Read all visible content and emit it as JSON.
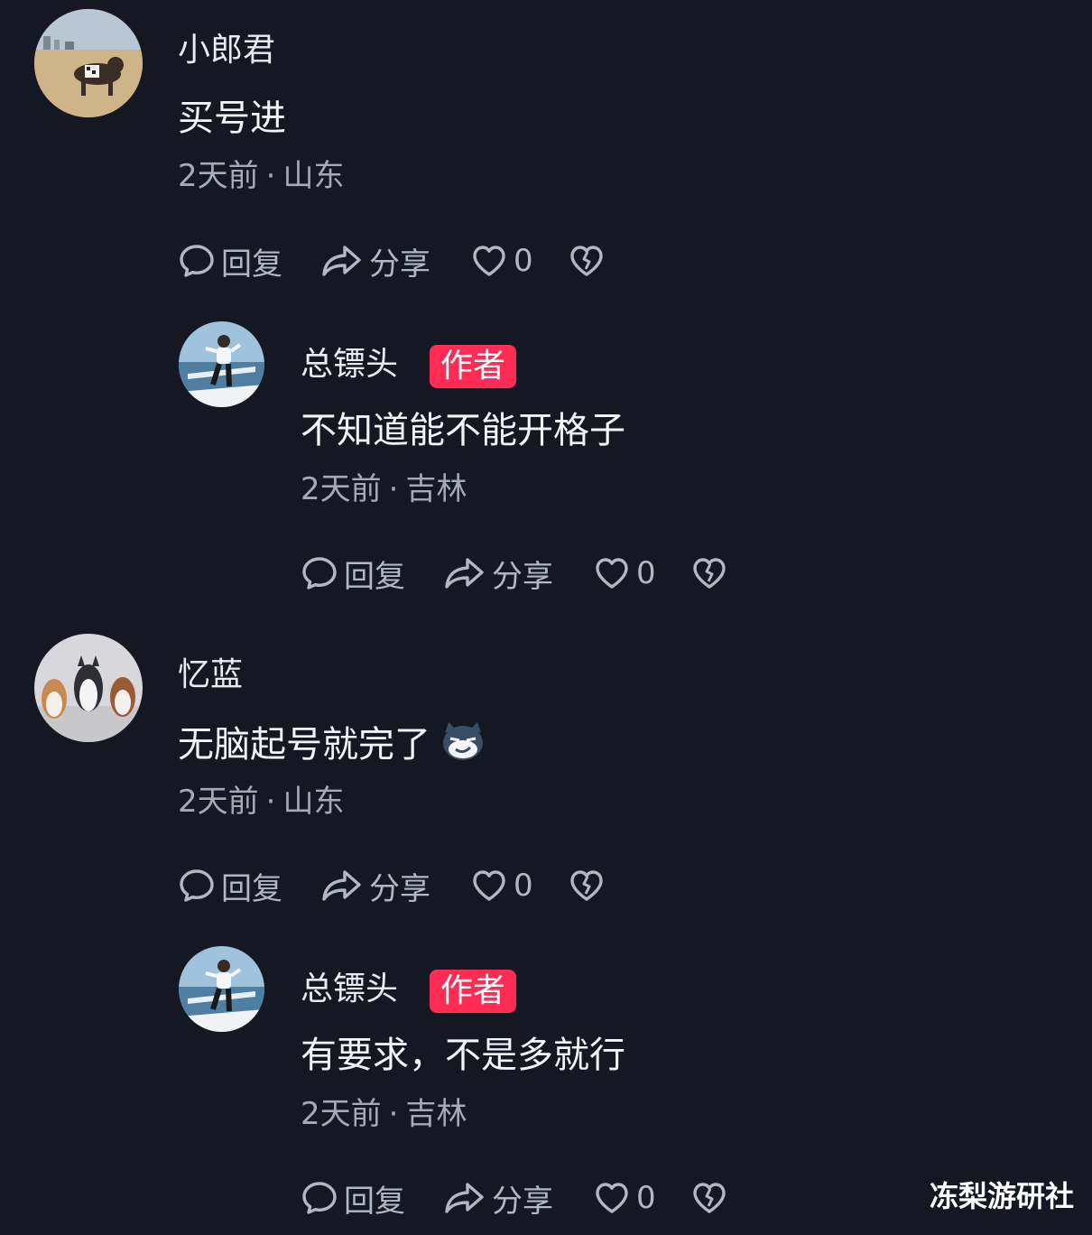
{
  "comments": [
    {
      "username": "小郎君",
      "content": "买号进",
      "time": "2天前",
      "location": "山东",
      "reply_label": "回复",
      "share_label": "分享",
      "likes": "0",
      "avatar_icon": "dog-avatar",
      "replies": [
        {
          "username": "总镖头",
          "badge": "作者",
          "content": "不知道能不能开格子",
          "time": "2天前",
          "location": "吉林",
          "reply_label": "回复",
          "share_label": "分享",
          "likes": "0",
          "avatar_icon": "man-on-boat-avatar"
        }
      ]
    },
    {
      "username": "忆蓝",
      "content": "无脑起号就完了",
      "emoji_icon": "sly-emoji",
      "time": "2天前",
      "location": "山东",
      "reply_label": "回复",
      "share_label": "分享",
      "likes": "0",
      "avatar_icon": "husky-dogs-avatar",
      "replies": [
        {
          "username": "总镖头",
          "badge": "作者",
          "content": "有要求，不是多就行",
          "time": "2天前",
          "location": "吉林",
          "reply_label": "回复",
          "share_label": "分享",
          "likes": "0",
          "avatar_icon": "man-on-boat-avatar"
        }
      ]
    }
  ],
  "watermark": "冻梨游研社",
  "colors": {
    "background": "#151823",
    "badge": "#fe2c55",
    "text_secondary": "#a6aab6"
  }
}
